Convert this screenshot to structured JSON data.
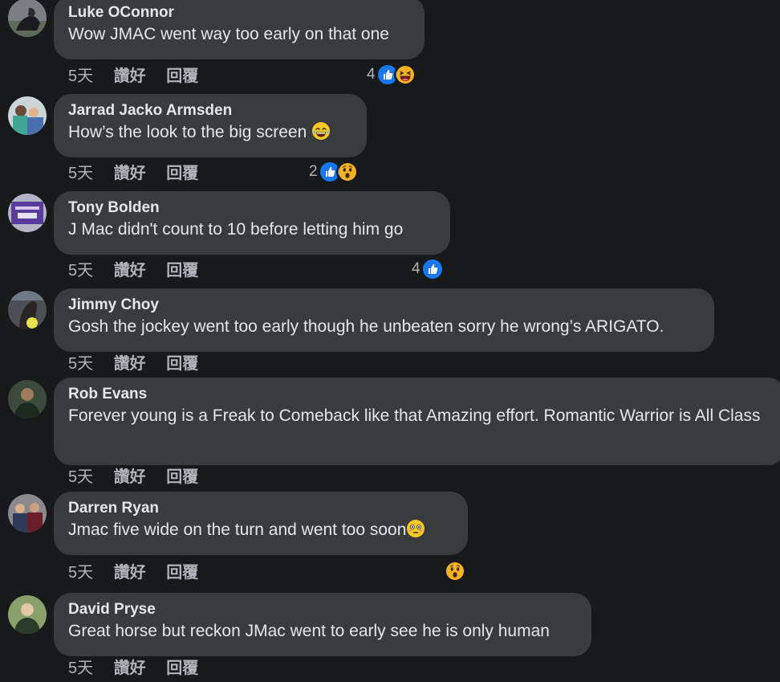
{
  "actions": {
    "time": "5天",
    "like": "讚好",
    "reply": "回覆"
  },
  "comments": [
    {
      "author": "Luke OConnor",
      "text": "Wow JMAC went way too early on that one",
      "reaction_count": "4",
      "reactions": [
        "like-icon",
        "laughing-emoji-icon"
      ]
    },
    {
      "author": "Jarrad Jacko Armsden",
      "text": "How’s the look to the big screen",
      "inline_emoji": "tears-of-joy-emoji-icon",
      "reaction_count": "2",
      "reactions": [
        "like-icon",
        "wow-emoji-icon"
      ]
    },
    {
      "author": "Tony Bolden",
      "text": "J Mac didn't count to 10 before letting him go",
      "reaction_count": "4",
      "reactions": [
        "like-icon"
      ]
    },
    {
      "author": "Jimmy Choy",
      "text": "Gosh the jockey went too early though he unbeaten sorry he wrong’s ARIGATO."
    },
    {
      "author": "Rob Evans",
      "text": "Forever young is a Freak to Comeback like that Amazing effort. Romantic Warrior is All Class"
    },
    {
      "author": "Darren Ryan",
      "text": "Jmac five wide on the turn and went too soon",
      "inline_emoji": "flushed-emoji-icon",
      "reactions": [
        "wow-emoji-icon"
      ]
    },
    {
      "author": "David Pryse",
      "text": "Great horse but reckon JMac went to early see he is only human"
    }
  ],
  "colors": {
    "background": "#18191a",
    "bubble": "#3a3b3c",
    "text": "#e4e6eb",
    "secondary_text": "#b0b3b8",
    "like_blue": "#1877f2"
  }
}
